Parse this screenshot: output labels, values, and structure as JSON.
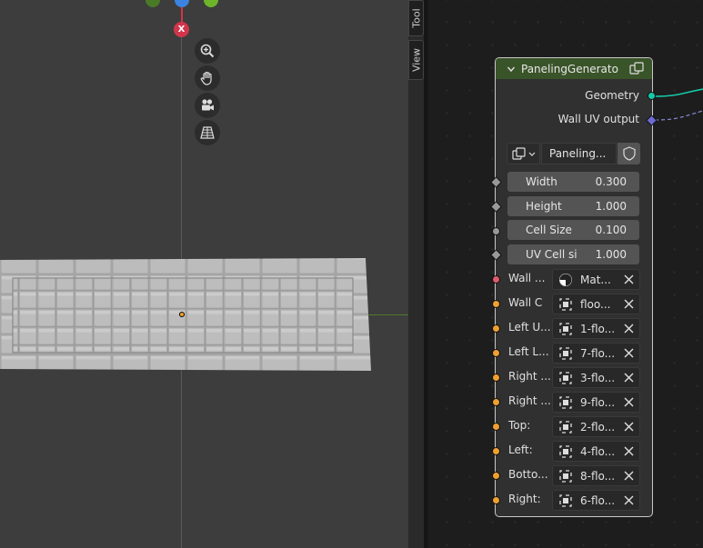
{
  "sidebar_tabs": [
    "Tool",
    "View"
  ],
  "viewport": {
    "gizmo_axis_label": "X",
    "nav_buttons": [
      "zoom-icon",
      "hand-pan-icon",
      "camera-icon",
      "grid-perspective-icon"
    ]
  },
  "node": {
    "title": "PanelingGenerato",
    "outputs": [
      {
        "label": "Geometry",
        "socket_color": "#16c8a8"
      },
      {
        "label": "Wall UV output",
        "socket_color": "#6b6bd0"
      }
    ],
    "group_name": "Paneling...",
    "number_inputs": [
      {
        "label": "Width",
        "value": "0.300"
      },
      {
        "label": "Height",
        "value": "1.000"
      },
      {
        "label": "Cell Size",
        "value": "0.100"
      },
      {
        "label": "UV Cell si",
        "value": "1.000"
      }
    ],
    "data_inputs": [
      {
        "label": "Wall ...",
        "value": "Mat...",
        "icon": "material-icon",
        "socket_color": "#e05a6b"
      },
      {
        "label": "Wall C",
        "value": "floo...",
        "icon": "collection-icon",
        "socket_color": "#f0a030"
      },
      {
        "label": "Left U...",
        "value": "1-flo...",
        "icon": "collection-icon",
        "socket_color": "#f0a030"
      },
      {
        "label": "Left L...",
        "value": "7-flo...",
        "icon": "collection-icon",
        "socket_color": "#f0a030"
      },
      {
        "label": "Right ...",
        "value": "3-flo...",
        "icon": "collection-icon",
        "socket_color": "#f0a030"
      },
      {
        "label": "Right ...",
        "value": "9-flo...",
        "icon": "collection-icon",
        "socket_color": "#f0a030"
      },
      {
        "label": "Top:",
        "value": "2-flo...",
        "icon": "collection-icon",
        "socket_color": "#f0a030"
      },
      {
        "label": "Left:",
        "value": "4-flo...",
        "icon": "collection-icon",
        "socket_color": "#f0a030"
      },
      {
        "label": "Botto...",
        "value": "8-flo...",
        "icon": "collection-icon",
        "socket_color": "#f0a030"
      },
      {
        "label": "Right:",
        "value": "6-flo...",
        "icon": "collection-icon",
        "socket_color": "#f0a030"
      }
    ]
  }
}
